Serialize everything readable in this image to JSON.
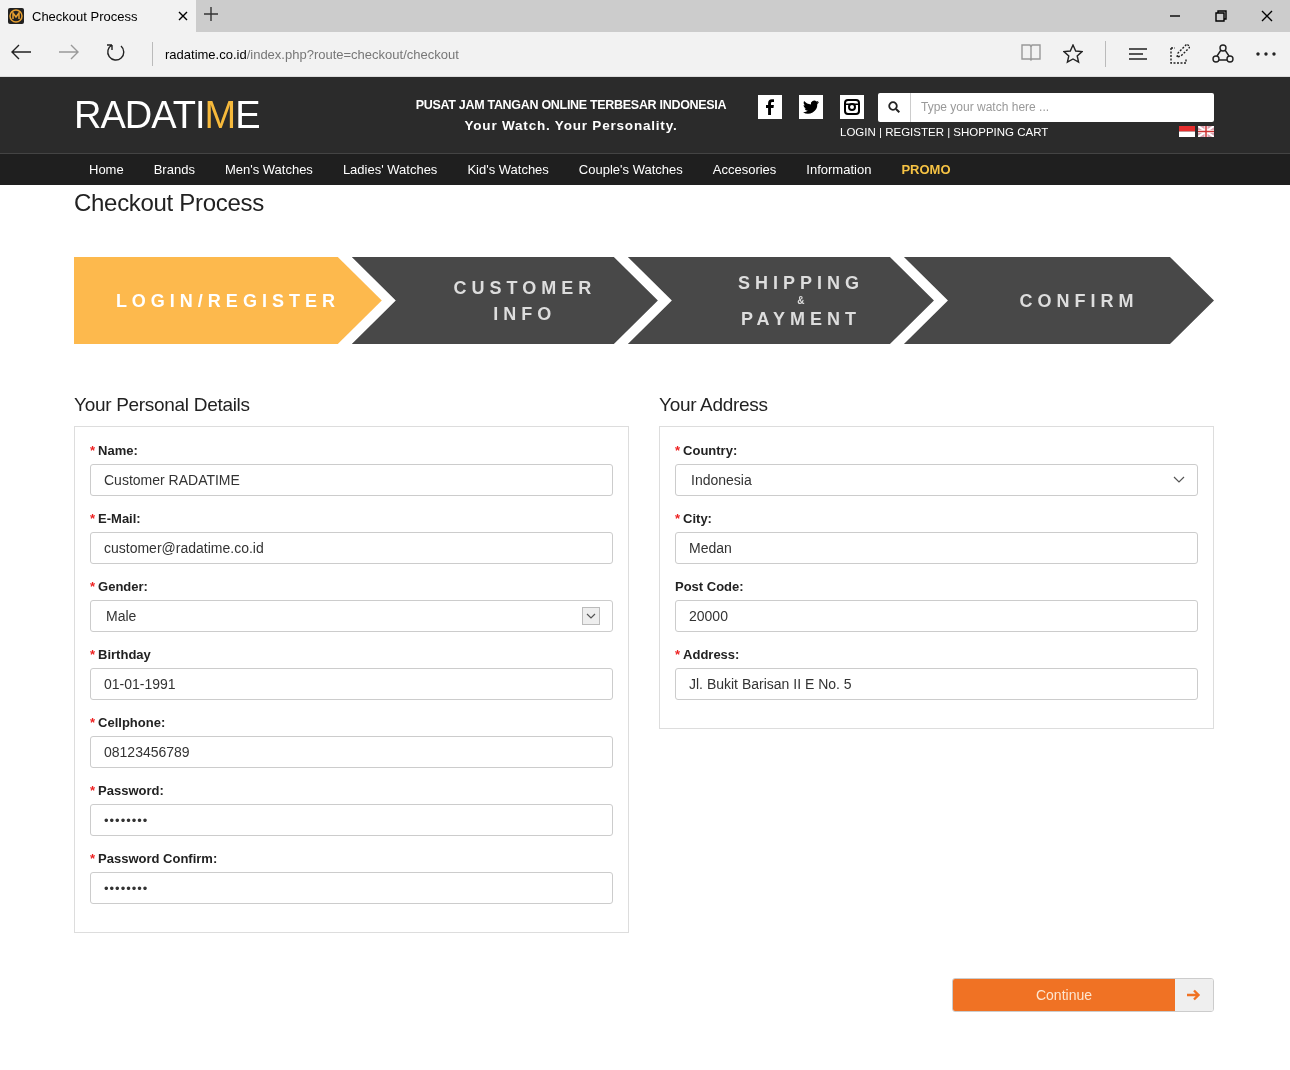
{
  "browser": {
    "tab_title": "Checkout Process",
    "url_host": "radatime.co.id",
    "url_path": "/index.php?route=checkout/checkout"
  },
  "header": {
    "logo": [
      {
        "text": "RADATI",
        "accent": false
      },
      {
        "text": "M",
        "accent": true
      },
      {
        "text": "E",
        "accent": false
      }
    ],
    "tagline": "PUSAT JAM TANGAN ONLINE TERBESAR INDONESIA",
    "slogan": "Your Watch. Your Personality.",
    "search": {
      "placeholder": "Type your watch here ..."
    },
    "account_links": "LOGIN | REGISTER | SHOPPING CART"
  },
  "nav": [
    {
      "label": "Home",
      "highlighted": false
    },
    {
      "label": "Brands",
      "highlighted": false
    },
    {
      "label": "Men's Watches",
      "highlighted": false
    },
    {
      "label": "Ladies' Watches",
      "highlighted": false
    },
    {
      "label": "Kid's Watches",
      "highlighted": false
    },
    {
      "label": "Couple's Watches",
      "highlighted": false
    },
    {
      "label": "Accesories",
      "highlighted": false
    },
    {
      "label": "Information",
      "highlighted": false
    },
    {
      "label": "PROMO",
      "highlighted": true
    }
  ],
  "page_title": "Checkout Process",
  "steps": [
    {
      "lines": [
        "LOGIN/REGISTER"
      ],
      "selected": true
    },
    {
      "lines": [
        "CUSTOMER",
        "INFO"
      ],
      "selected": false
    },
    {
      "lines": [
        "SHIPPING",
        "&",
        "PAYMENT"
      ],
      "selected": false
    },
    {
      "lines": [
        "CONFIRM"
      ],
      "selected": false
    }
  ],
  "personal": {
    "title": "Your Personal Details",
    "fields": [
      {
        "required_mark": "*",
        "label": "Name:",
        "kind": "text",
        "value": "Customer RADATIME"
      },
      {
        "required_mark": "*",
        "label": "E-Mail:",
        "kind": "text",
        "value": "customer@radatime.co.id"
      },
      {
        "required_mark": "*",
        "label": "Gender:",
        "kind": "select-box",
        "value": "Male"
      },
      {
        "required_mark": "*",
        "label": "Birthday",
        "kind": "text",
        "value": "01-01-1991"
      },
      {
        "required_mark": "*",
        "label": "Cellphone:",
        "kind": "text",
        "value": "08123456789"
      },
      {
        "required_mark": "*",
        "label": "Password:",
        "kind": "password",
        "value": "••••••••"
      },
      {
        "required_mark": "*",
        "label": "Password Confirm:",
        "kind": "password",
        "value": "••••••••"
      }
    ]
  },
  "address": {
    "title": "Your Address",
    "fields": [
      {
        "required_mark": "*",
        "label": "Country:",
        "kind": "select-chevron",
        "value": "Indonesia"
      },
      {
        "required_mark": "*",
        "label": "City:",
        "kind": "text",
        "value": "Medan"
      },
      {
        "label": "Post Code:",
        "kind": "text",
        "value": "20000"
      },
      {
        "required_mark": "*",
        "label": "Address:",
        "kind": "text",
        "value": "Jl. Bukit Barisan II E No. 5"
      }
    ]
  },
  "continue_button": "Continue"
}
